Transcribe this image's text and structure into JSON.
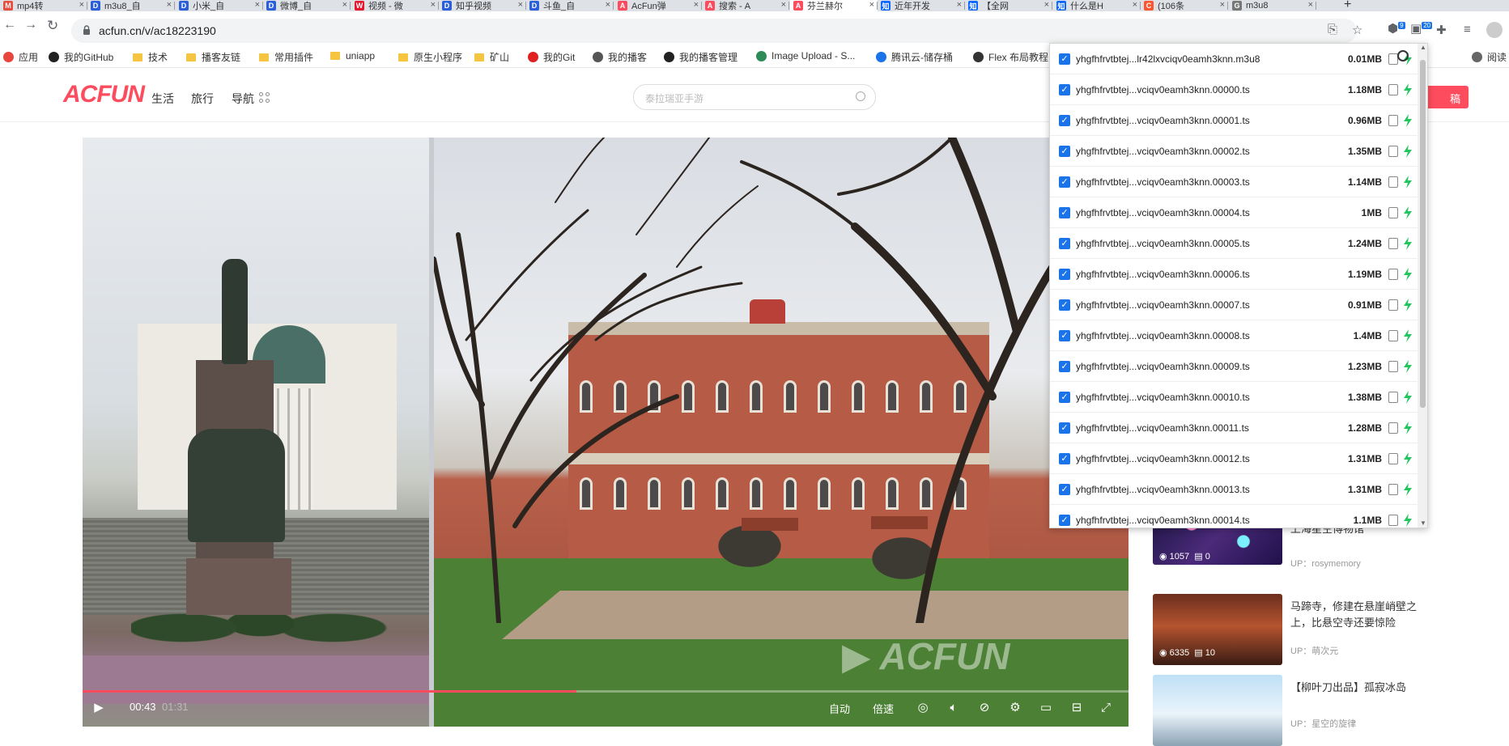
{
  "browser": {
    "tabs": [
      {
        "label": "mp4转",
        "fav_color": "#e84c3d",
        "fav_glyph": "M"
      },
      {
        "label": "m3u8_自",
        "fav_color": "#2b5fd9",
        "fav_glyph": "D"
      },
      {
        "label": "小米_自",
        "fav_color": "#2b5fd9",
        "fav_glyph": "D"
      },
      {
        "label": "微博_自",
        "fav_color": "#2b5fd9",
        "fav_glyph": "D"
      },
      {
        "label": "视频 - 微",
        "fav_color": "#e6162d",
        "fav_glyph": "W"
      },
      {
        "label": "知乎视频",
        "fav_color": "#2b5fd9",
        "fav_glyph": "D"
      },
      {
        "label": "斗鱼_自",
        "fav_color": "#2b5fd9",
        "fav_glyph": "D"
      },
      {
        "label": "AcFun弹",
        "fav_color": "#fd4c5d",
        "fav_glyph": "A"
      },
      {
        "label": "搜索 - A",
        "fav_color": "#fd4c5d",
        "fav_glyph": "A"
      },
      {
        "label": "芬兰赫尔",
        "fav_color": "#fd4c5d",
        "fav_glyph": "A"
      },
      {
        "label": "近年开发",
        "fav_color": "#0a66ff",
        "fav_glyph": "知"
      },
      {
        "label": "【全网",
        "fav_color": "#0a66ff",
        "fav_glyph": "知"
      },
      {
        "label": "什么是H",
        "fav_color": "#0a66ff",
        "fav_glyph": "知"
      },
      {
        "label": "(106条",
        "fav_color": "#fc5531",
        "fav_glyph": "C"
      },
      {
        "label": "m3u8",
        "fav_color": "#777777",
        "fav_glyph": "G"
      }
    ],
    "active_tab_index": 9,
    "url": "acfun.cn/v/ac18223190",
    "bookmarks": [
      {
        "label": "应用",
        "kind": "apps"
      },
      {
        "label": "我的GitHub",
        "kind": "github"
      },
      {
        "label": "技术",
        "kind": "folder"
      },
      {
        "label": "播客友链",
        "kind": "folder"
      },
      {
        "label": "常用插件",
        "kind": "folder"
      },
      {
        "label": "uniapp",
        "kind": "folder"
      },
      {
        "label": "原生小程序",
        "kind": "folder"
      },
      {
        "label": "矿山",
        "kind": "folder"
      },
      {
        "label": "我的Git",
        "kind": "git"
      },
      {
        "label": "我的播客",
        "kind": "podcast"
      },
      {
        "label": "我的播客管理",
        "kind": "admin"
      },
      {
        "label": "Image Upload - S...",
        "kind": "chart"
      },
      {
        "label": "腾讯云-储存桶",
        "kind": "cloud"
      },
      {
        "label": "Flex 布局教程",
        "kind": "flex"
      },
      {
        "label": "阅读",
        "kind": "reading"
      }
    ],
    "extension_badges": [
      "9",
      "20"
    ]
  },
  "site": {
    "logo": "ACFUN",
    "nav": [
      "生活",
      "旅行",
      "导航"
    ],
    "search_placeholder": "泰拉瑞亚手游",
    "header_button": "稿"
  },
  "player": {
    "current_time": "00:43",
    "duration": "01:31",
    "progress": 0.4725,
    "watermark": "ACFUN",
    "controls": [
      "自动",
      "倍速"
    ]
  },
  "recommendations": [
    {
      "title": "上海星空博物馆",
      "up": "UP：rosymemory",
      "views": "1057",
      "comments": "0"
    },
    {
      "title": "马蹄寺，修建在悬崖峭壁之上，比悬空寺还要惊险",
      "up": "UP：萌次元",
      "views": "6335",
      "comments": "10"
    },
    {
      "title": "【柳叶刀出品】孤寂冰岛",
      "up": "UP：星空的旋律",
      "views": "",
      "comments": ""
    }
  ],
  "downloader": {
    "items": [
      {
        "name": "yhgfhfrvtbtej...lr42lxvciqv0eamh3knn.m3u8",
        "size": "0.01MB"
      },
      {
        "name": "yhgfhfrvtbtej...vciqv0eamh3knn.00000.ts",
        "size": "1.18MB"
      },
      {
        "name": "yhgfhfrvtbtej...vciqv0eamh3knn.00001.ts",
        "size": "0.96MB"
      },
      {
        "name": "yhgfhfrvtbtej...vciqv0eamh3knn.00002.ts",
        "size": "1.35MB"
      },
      {
        "name": "yhgfhfrvtbtej...vciqv0eamh3knn.00003.ts",
        "size": "1.14MB"
      },
      {
        "name": "yhgfhfrvtbtej...vciqv0eamh3knn.00004.ts",
        "size": "1MB"
      },
      {
        "name": "yhgfhfrvtbtej...vciqv0eamh3knn.00005.ts",
        "size": "1.24MB"
      },
      {
        "name": "yhgfhfrvtbtej...vciqv0eamh3knn.00006.ts",
        "size": "1.19MB"
      },
      {
        "name": "yhgfhfrvtbtej...vciqv0eamh3knn.00007.ts",
        "size": "0.91MB"
      },
      {
        "name": "yhgfhfrvtbtej...vciqv0eamh3knn.00008.ts",
        "size": "1.4MB"
      },
      {
        "name": "yhgfhfrvtbtej...vciqv0eamh3knn.00009.ts",
        "size": "1.23MB"
      },
      {
        "name": "yhgfhfrvtbtej...vciqv0eamh3knn.00010.ts",
        "size": "1.38MB"
      },
      {
        "name": "yhgfhfrvtbtej...vciqv0eamh3knn.00011.ts",
        "size": "1.28MB"
      },
      {
        "name": "yhgfhfrvtbtej...vciqv0eamh3knn.00012.ts",
        "size": "1.31MB"
      },
      {
        "name": "yhgfhfrvtbtej...vciqv0eamh3knn.00013.ts",
        "size": "1.31MB"
      },
      {
        "name": "yhgfhfrvtbtej...vciqv0eamh3knn.00014.ts",
        "size": "1.1MB"
      }
    ]
  },
  "colors": {
    "brand": "#fd4c5d",
    "checkbox": "#1a73e8",
    "download": "#22c55e"
  }
}
